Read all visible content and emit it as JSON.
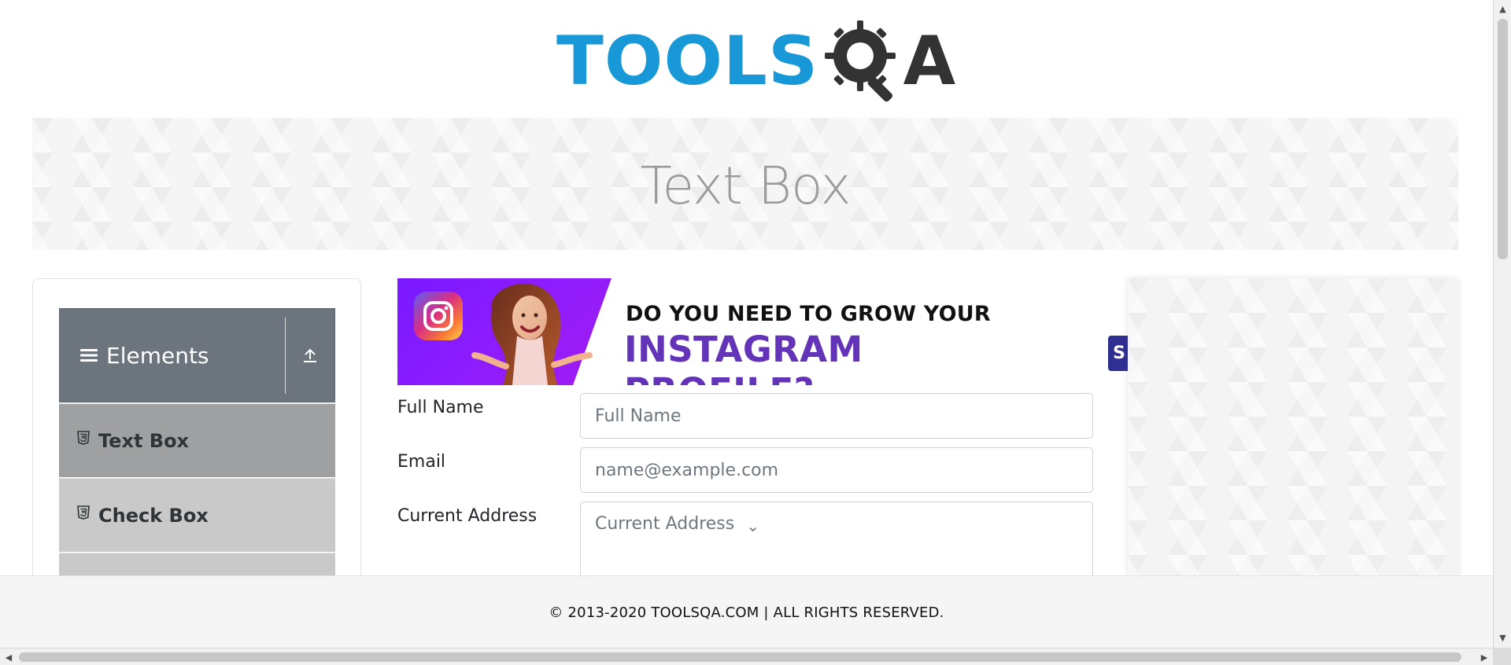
{
  "logo": {
    "left_text": "TOOLS",
    "right_text": "A",
    "brand_blue": "#1898d6",
    "brand_dark": "#333333"
  },
  "header": {
    "title": "Text Box"
  },
  "sidebar": {
    "group_title": "Elements",
    "items": [
      {
        "label": "Text Box"
      },
      {
        "label": "Check Box"
      }
    ]
  },
  "ad": {
    "headline_top": "DO YOU NEED TO GROW YOUR",
    "headline_bottom": "INSTAGRAM PROFILE?",
    "cta_partial": "S",
    "accent": "#6333b8",
    "gradient_start": "#7a19ff",
    "gradient_end": "#a31bf0"
  },
  "form": {
    "full_name_label": "Full Name",
    "full_name_placeholder": "Full Name",
    "email_label": "Email",
    "email_placeholder": "name@example.com",
    "current_address_label": "Current Address",
    "current_address_placeholder": "Current Address"
  },
  "footer": {
    "text": "© 2013-2020 TOOLSQA.COM | ALL RIGHTS RESERVED."
  },
  "icons": {
    "menu": "hamburger-icon",
    "collapse": "upload-arrow-icon",
    "html5": "html5-icon",
    "instagram": "instagram-icon",
    "chevron": "chevron-down-icon"
  }
}
